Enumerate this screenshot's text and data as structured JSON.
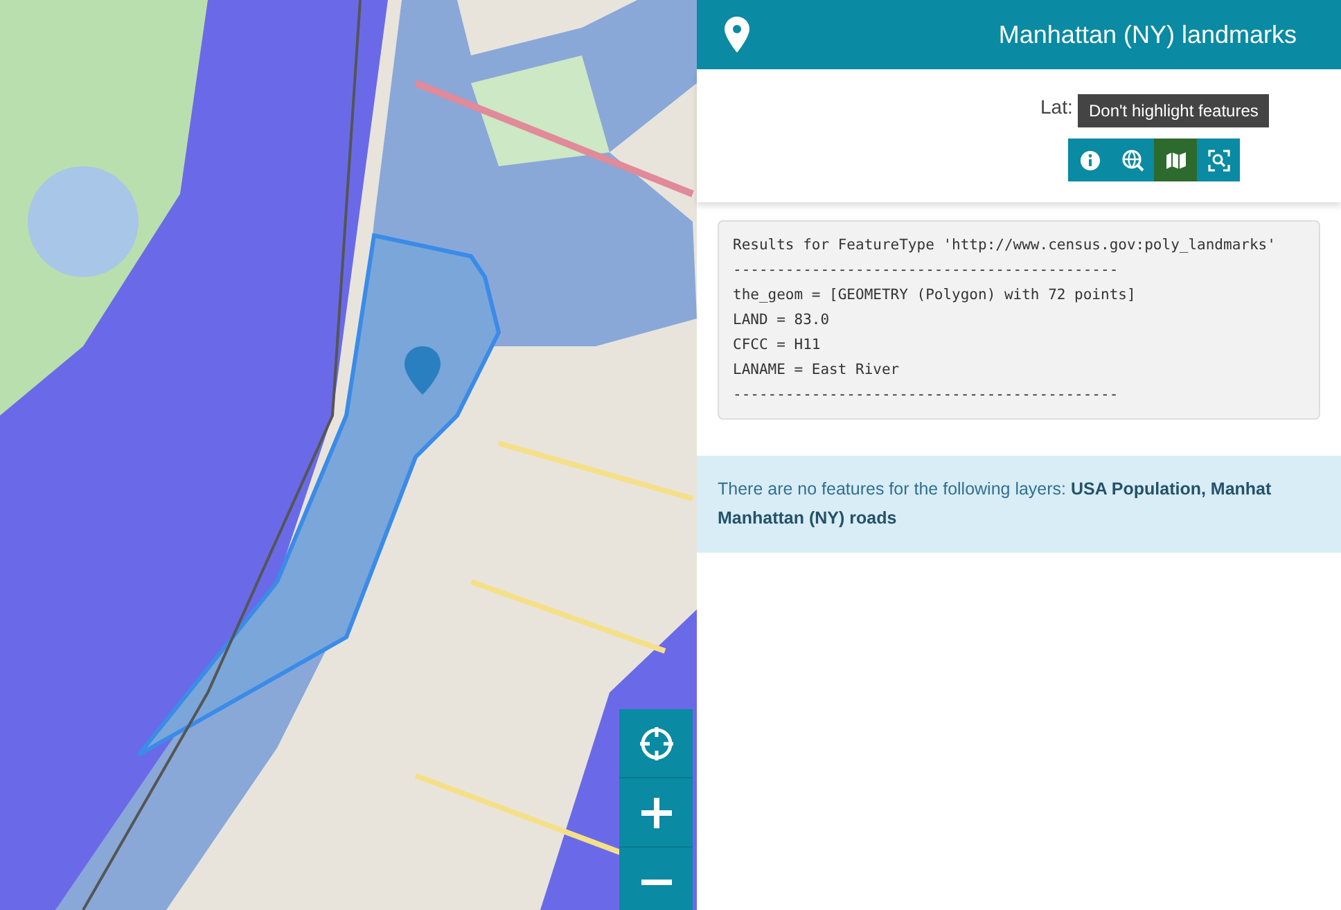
{
  "panel": {
    "title": "Manhattan (NY) landmarks",
    "coordinates_label": "Lat:",
    "tooltip": "Don't highlight features",
    "tools": [
      {
        "kind": "info",
        "selected": false
      },
      {
        "kind": "globe-search",
        "selected": false
      },
      {
        "kind": "highlight",
        "selected": true
      },
      {
        "kind": "zoom-to",
        "selected": false
      }
    ],
    "results": [
      "Results for FeatureType 'http://www.census.gov:poly_landmarks'",
      "--------------------------------------------",
      "the_geom = [GEOMETRY (Polygon) with 72 points]",
      "LAND = 83.0",
      "CFCC = H11",
      "LANAME = East River",
      "--------------------------------------------"
    ],
    "no_features": {
      "text": "There are no features for the following layers:",
      "layers": [
        "USA Population, Manhat",
        "Manhattan (NY) roads"
      ]
    }
  },
  "map_controls": [
    {
      "kind": "locate"
    },
    {
      "kind": "zoom-in"
    },
    {
      "kind": "zoom-out"
    }
  ]
}
